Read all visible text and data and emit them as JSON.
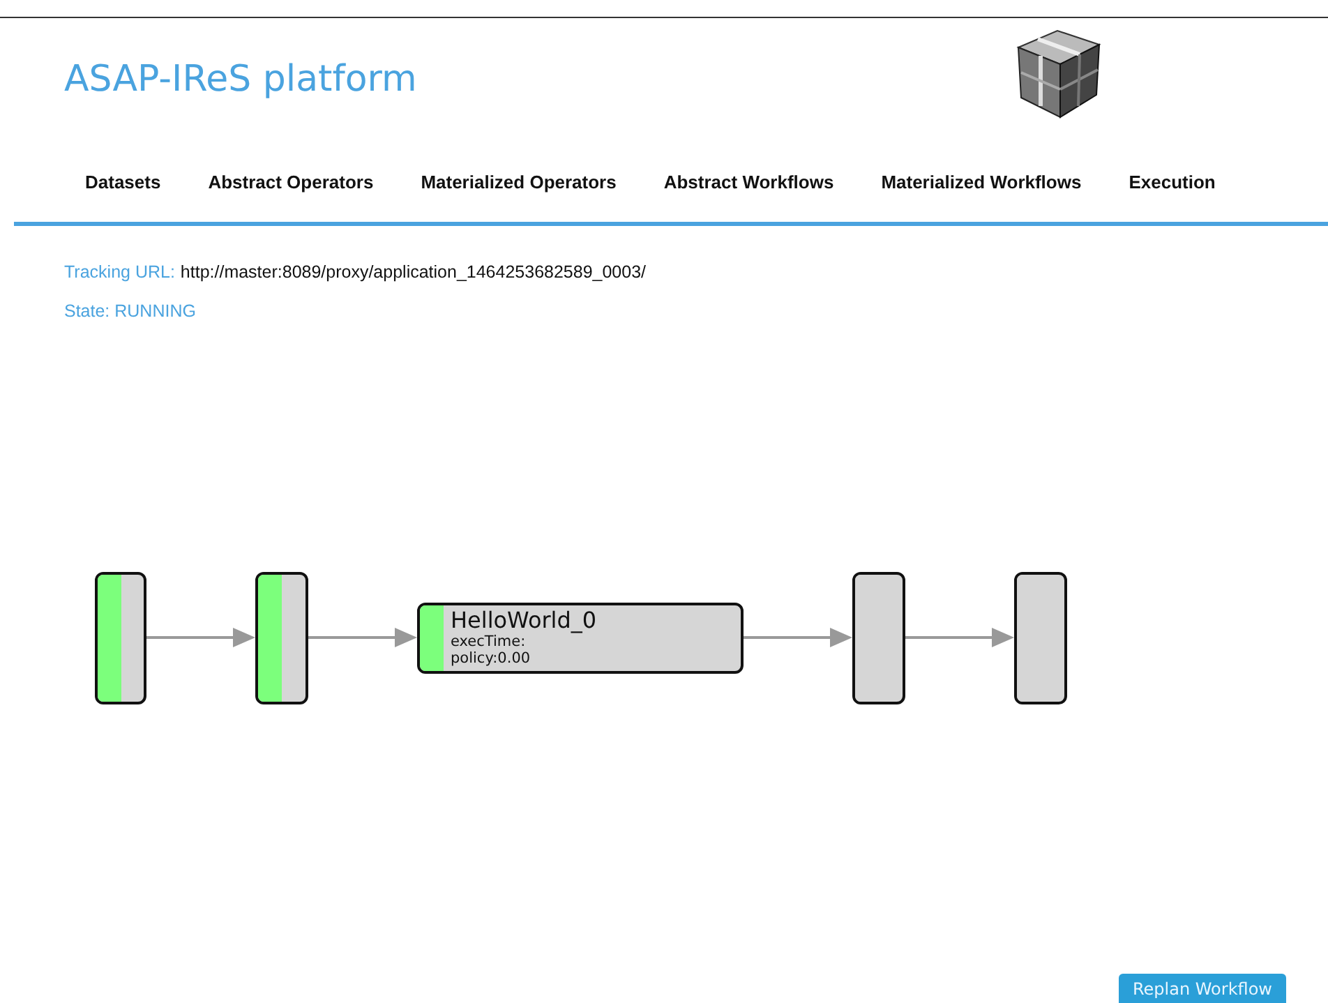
{
  "header": {
    "title": "ASAP-IReS platform"
  },
  "nav": [
    {
      "label": "Datasets",
      "selected": false
    },
    {
      "label": "Abstract Operators",
      "selected": false
    },
    {
      "label": "Materialized Operators",
      "selected": false
    },
    {
      "label": "Abstract Workflows",
      "selected": false
    },
    {
      "label": "Materialized Workflows",
      "selected": false
    },
    {
      "label": "Execution",
      "selected": false
    }
  ],
  "tracking": {
    "label": "Tracking URL:",
    "url": "http://master:8089/proxy/application_1464253682589_0003/"
  },
  "state": {
    "label": "State: RUNNING"
  },
  "workflow": {
    "nodes": [
      {
        "kind": "dataset",
        "completed": true
      },
      {
        "kind": "dataset",
        "completed": true
      },
      {
        "kind": "operator",
        "completed": true,
        "name": "HelloWorld_0",
        "exec_time": "execTime:",
        "policy": "policy:0.00"
      },
      {
        "kind": "dataset",
        "completed": false
      },
      {
        "kind": "dataset",
        "completed": false
      }
    ]
  },
  "buttons": [
    {
      "label": "Replan Workflow"
    }
  ]
}
